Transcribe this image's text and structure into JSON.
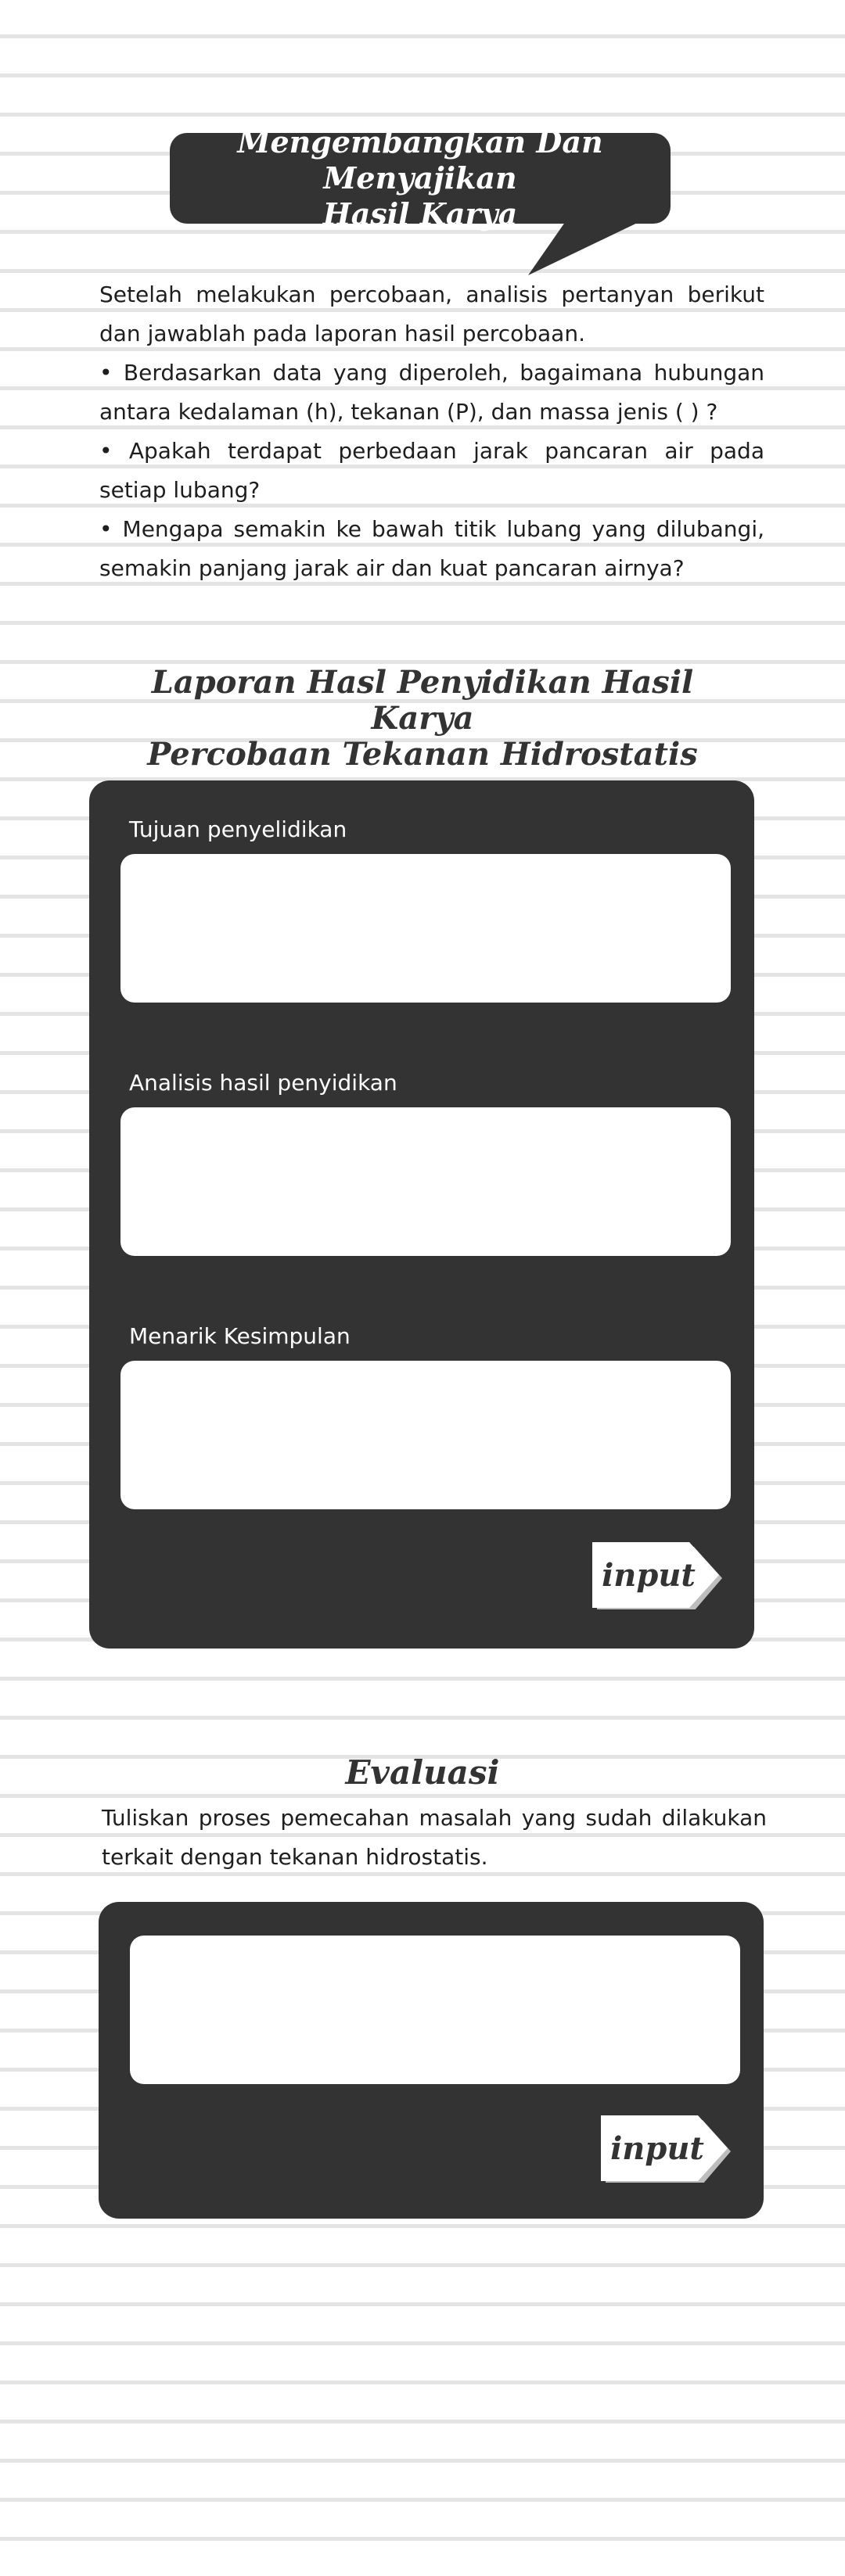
{
  "header": {
    "bubble_line1": "Mengembangkan Dan Menyajikan",
    "bubble_line2": "Hasil  Karya"
  },
  "intro": {
    "paragraph": "Setelah melakukan percobaan, analisis pertanyan berikut dan jawablah pada laporan hasil percobaan.",
    "bullets": [
      "• Berdasarkan data yang diperoleh, bagaimana hubungan antara kedalaman (h), tekanan (P), dan massa jenis ( ) ?",
      "• Apakah terdapat perbedaan jarak pancaran air pada setiap lubang?",
      "• Mengapa semakin ke bawah titik lubang yang dilubangi, semakin panjang jarak air dan kuat pancaran airnya?"
    ]
  },
  "report": {
    "title_line1": "Laporan Hasl Penyidikan Hasil Karya",
    "title_line2": "Percobaan Tekanan Hidrostatis",
    "fields": [
      {
        "label": "Tujuan penyelidikan",
        "value": ""
      },
      {
        "label": "Analisis hasil penyidikan",
        "value": ""
      },
      {
        "label": "Menarik Kesimpulan",
        "value": ""
      }
    ],
    "submit_label": "input"
  },
  "evaluation": {
    "title": "Evaluasi",
    "text": "Tuliskan proses pemecahan masalah yang sudah dilakukan terkait dengan tekanan hidrostatis.",
    "field_value": "",
    "submit_label": "input"
  },
  "colors": {
    "panel": "#333333",
    "background": "#ffffff",
    "rule_line": "#e4e4e4"
  }
}
